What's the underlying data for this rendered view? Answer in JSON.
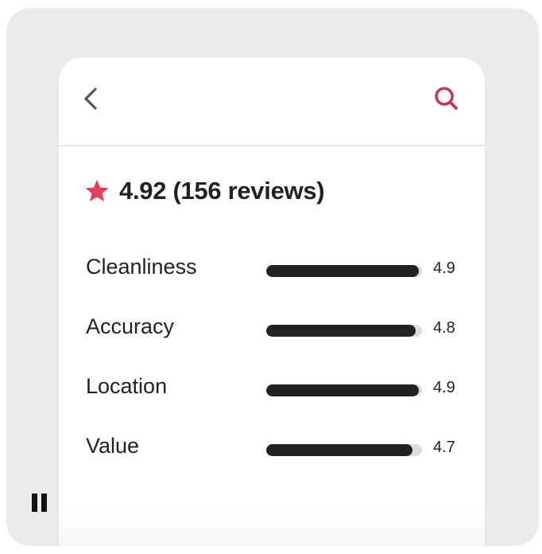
{
  "header": {
    "back_icon": "chevron-left-icon",
    "search_icon": "search-icon"
  },
  "summary": {
    "star_icon": "star-icon",
    "rating_text": "4.92 (156 reviews)",
    "accent_color": "#E0425E"
  },
  "categories": [
    {
      "label": "Cleanliness",
      "score": "4.9",
      "value": 4.9,
      "max": 5
    },
    {
      "label": "Accuracy",
      "score": "4.8",
      "value": 4.8,
      "max": 5
    },
    {
      "label": "Location",
      "score": "4.9",
      "value": 4.9,
      "max": 5
    },
    {
      "label": "Value",
      "score": "4.7",
      "value": 4.7,
      "max": 5
    }
  ],
  "media_control": {
    "icon": "pause-icon"
  }
}
